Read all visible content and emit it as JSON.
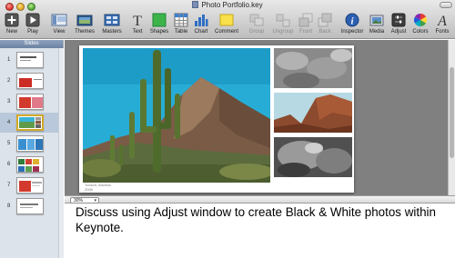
{
  "window": {
    "title": "Photo Portfolio.key"
  },
  "toolbar": {
    "items": [
      {
        "label": "New",
        "icon": "plus-icon",
        "enabled": true
      },
      {
        "label": "Play",
        "icon": "play-icon",
        "enabled": true
      },
      {
        "label": "View",
        "icon": "view-icon",
        "enabled": true
      },
      {
        "label": "Themes",
        "icon": "themes-icon",
        "enabled": true
      },
      {
        "label": "Masters",
        "icon": "masters-icon",
        "enabled": true
      },
      {
        "label": "Text",
        "icon": "text-icon",
        "enabled": true
      },
      {
        "label": "Shapes",
        "icon": "shapes-icon",
        "enabled": true
      },
      {
        "label": "Table",
        "icon": "table-icon",
        "enabled": true
      },
      {
        "label": "Chart",
        "icon": "chart-icon",
        "enabled": true
      },
      {
        "label": "Comment",
        "icon": "comment-icon",
        "enabled": true
      },
      {
        "label": "Group",
        "icon": "group-icon",
        "enabled": false
      },
      {
        "label": "Ungroup",
        "icon": "ungroup-icon",
        "enabled": false
      },
      {
        "label": "Front",
        "icon": "front-icon",
        "enabled": false
      },
      {
        "label": "Back",
        "icon": "back-icon",
        "enabled": false
      },
      {
        "label": "Inspector",
        "icon": "inspector-icon",
        "enabled": true
      },
      {
        "label": "Media",
        "icon": "media-icon",
        "enabled": true
      },
      {
        "label": "Adjust",
        "icon": "adjust-icon",
        "enabled": true
      },
      {
        "label": "Colors",
        "icon": "colors-icon",
        "enabled": true
      },
      {
        "label": "Fonts",
        "icon": "fonts-icon",
        "enabled": true
      }
    ]
  },
  "sidebar": {
    "header": "Slides",
    "slides": [
      {
        "number": "1",
        "selected": false
      },
      {
        "number": "2",
        "selected": false
      },
      {
        "number": "3",
        "selected": false
      },
      {
        "number": "4",
        "selected": true
      },
      {
        "number": "5",
        "selected": false
      },
      {
        "number": "6",
        "selected": false
      },
      {
        "number": "7",
        "selected": false
      },
      {
        "number": "8",
        "selected": false
      }
    ]
  },
  "slide": {
    "caption_line1": "Tucson, Arizona",
    "caption_line2": "2005"
  },
  "zoom": {
    "value": "30%"
  },
  "notes": {
    "text": "Discuss using Adjust window to create Black & White photos within Keynote."
  },
  "colors": {
    "sidebar_bg": "#dde3ea",
    "selection_border": "#d2a92a",
    "canvas_bg": "#808080",
    "sky": "#2bb0d8"
  }
}
